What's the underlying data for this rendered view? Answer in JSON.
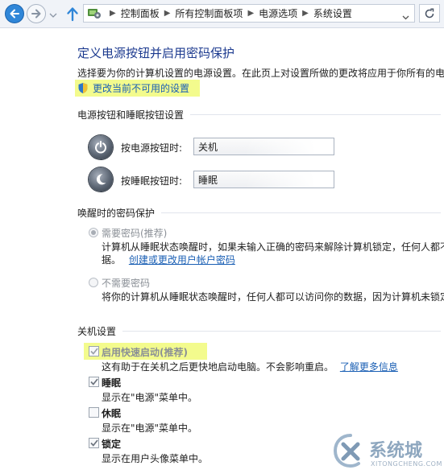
{
  "breadcrumbs": [
    "控制面板",
    "所有控制面板项",
    "电源选项",
    "系统设置"
  ],
  "page": {
    "title": "定义电源按钮并启用密码保护",
    "description": "选择要为你的计算机设置的电源设置。在此页上对设置所做的更改将应用于你所有的电",
    "change_unavailable_link": "更改当前不可用的设置"
  },
  "power_buttons": {
    "heading": "电源按钮和睡眠按钮设置",
    "power_label": "按电源按钮时:",
    "power_value": "关机",
    "sleep_label": "按睡眠按钮时:",
    "sleep_value": "睡眠"
  },
  "wake_password": {
    "heading": "唤醒时的密码保护",
    "require_label": "需要密码(推荐)",
    "require_desc_line1": "计算机从睡眠状态唤醒时，如果未输入正确的密码来解除计算机锁定，任何人都不",
    "require_desc_line2": "据。",
    "create_password_link": "创建或更改用户帐户密码",
    "no_require_label": "不需要密码",
    "no_require_desc": "将你的计算机从睡眠状态唤醒时，任何人都可以访问你的数据，因为计算机未锁定"
  },
  "shutdown": {
    "heading": "关机设置",
    "fast_startup_label": "启用快速启动(推荐)",
    "fast_startup_desc": "这有助于在关机之后更快地启动电脑。不会影响重启。",
    "learn_more_link": "了解更多信息",
    "sleep_label": "睡眠",
    "sleep_desc": "显示在\"电源\"菜单中。",
    "hibernate_label": "休眠",
    "hibernate_desc": "显示在\"电源\"菜单中。",
    "lock_label": "锁定",
    "lock_desc": "显示在用户头像菜单中。"
  },
  "watermark": {
    "brand": "系统城",
    "url": "XITONGCHENG.COM"
  },
  "colors": {
    "highlight": "#f3fb8d",
    "link": "#1a5fb4",
    "title": "#1c3a8f",
    "back_button": "#2f86d8"
  },
  "icons": {
    "back": "arrow-left-icon",
    "forward": "arrow-right-icon",
    "up": "arrow-up-icon",
    "control_panel": "control-panel-icon",
    "refresh": "refresh-icon",
    "shield": "uac-shield-icon",
    "power": "power-icon",
    "sleep": "moon-icon"
  }
}
